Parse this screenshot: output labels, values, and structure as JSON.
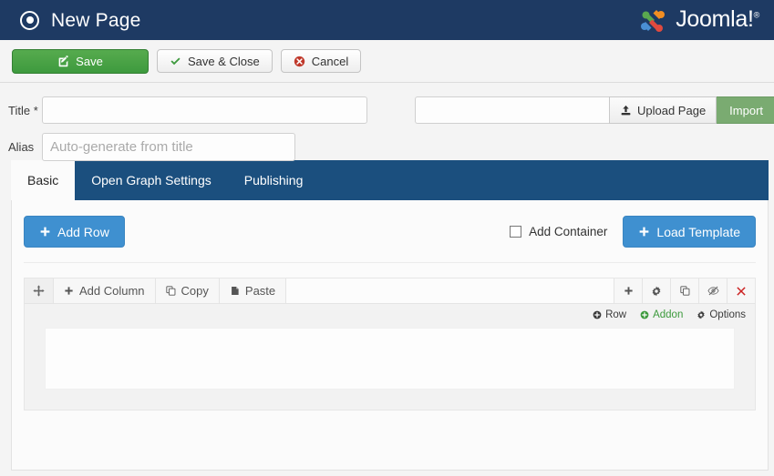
{
  "header": {
    "icon": "target-circle-icon",
    "title": "New Page",
    "brand": "Joomla!",
    "brand_sup": "®",
    "bg_color": "#1e3a63"
  },
  "toolbar": {
    "save_label": "Save",
    "save_icon": "pencil-square-icon",
    "save_close_label": "Save & Close",
    "save_close_icon": "check-icon",
    "cancel_label": "Cancel",
    "cancel_icon": "times-circle-icon",
    "save_color": "#3e9a3e"
  },
  "form": {
    "title_label": "Title *",
    "title_value": "",
    "title_placeholder": "",
    "alias_label": "Alias",
    "alias_value": "",
    "alias_placeholder": "Auto-generate from title",
    "upload_value": "",
    "upload_placeholder": "",
    "upload_button_label": "Upload Page",
    "upload_button_icon": "upload-icon",
    "import_button_label": "Import",
    "import_color": "#7aab71"
  },
  "tabs": {
    "bg_color": "#1b4f7e",
    "items": [
      {
        "label": "Basic",
        "active": true
      },
      {
        "label": "Open Graph Settings",
        "active": false
      },
      {
        "label": "Publishing",
        "active": false
      }
    ]
  },
  "builder": {
    "add_row_label": "Add Row",
    "add_row_icon": "plus-icon",
    "add_container_label": "Add Container",
    "add_container_checked": false,
    "load_template_label": "Load Template",
    "load_template_icon": "plus-icon",
    "accent_color": "#3f90d0",
    "row": {
      "drag_handle_icon": "arrows-move-icon",
      "add_column_label": "Add Column",
      "add_column_icon": "plus-icon",
      "copy_label": "Copy",
      "copy_icon": "copy-icon",
      "paste_label": "Paste",
      "paste_icon": "clipboard-icon",
      "icons": [
        {
          "name": "plus-icon",
          "glyph": "+",
          "danger": false
        },
        {
          "name": "gear-icon",
          "glyph": "⚙",
          "danger": false
        },
        {
          "name": "duplicate-icon",
          "glyph": "⧉",
          "danger": false
        },
        {
          "name": "eye-slash-icon",
          "glyph": "⌀",
          "danger": false
        },
        {
          "name": "delete-icon",
          "glyph": "✖",
          "danger": true
        }
      ],
      "links": [
        {
          "label": "Row",
          "icon": "plus-circle-icon",
          "green": false
        },
        {
          "label": "Addon",
          "icon": "plus-circle-icon",
          "green": true
        },
        {
          "label": "Options",
          "icon": "gear-icon",
          "green": false
        }
      ]
    }
  }
}
